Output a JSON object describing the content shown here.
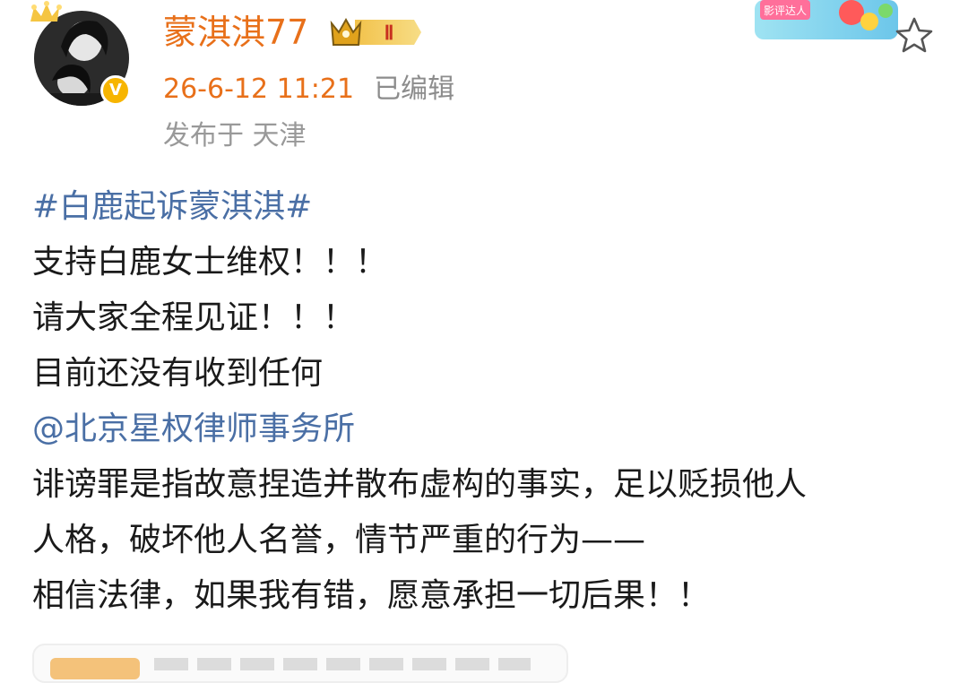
{
  "post": {
    "author": {
      "name": "蒙淇淇77",
      "vip_level": "Ⅱ",
      "verified": "V",
      "avatar": "avatar-photo",
      "decoration": "crown-sparkle-icon"
    },
    "time": "26-6-12 11:21",
    "edited": "已编辑",
    "location": "发布于 天津",
    "sticker_label": "影评达人",
    "favorite_icon": "star-outline-icon",
    "lines": [
      {
        "text": "#白鹿起诉蒙淇淇#",
        "kind": "hashtag"
      },
      {
        "text": "支持白鹿女士维权！！！",
        "kind": "text"
      },
      {
        "text": "请大家全程见证！！！",
        "kind": "text"
      },
      {
        "text": "目前还没有收到任何",
        "kind": "text"
      },
      {
        "text": "@北京星权律师事务所",
        "kind": "mention"
      },
      {
        "text": "诽谤罪是指故意捏造并散布虚构的事实，足以贬损他人",
        "kind": "text"
      },
      {
        "text": "人格，破坏他人名誉，情节严重的行为——",
        "kind": "text"
      },
      {
        "text": "相信法律，如果我有错，愿意承担一切后果！！",
        "kind": "text"
      }
    ]
  },
  "colors": {
    "username": "#e8701a",
    "link": "#4a6fa5",
    "meta": "#999999",
    "text": "#1a1a1a"
  }
}
